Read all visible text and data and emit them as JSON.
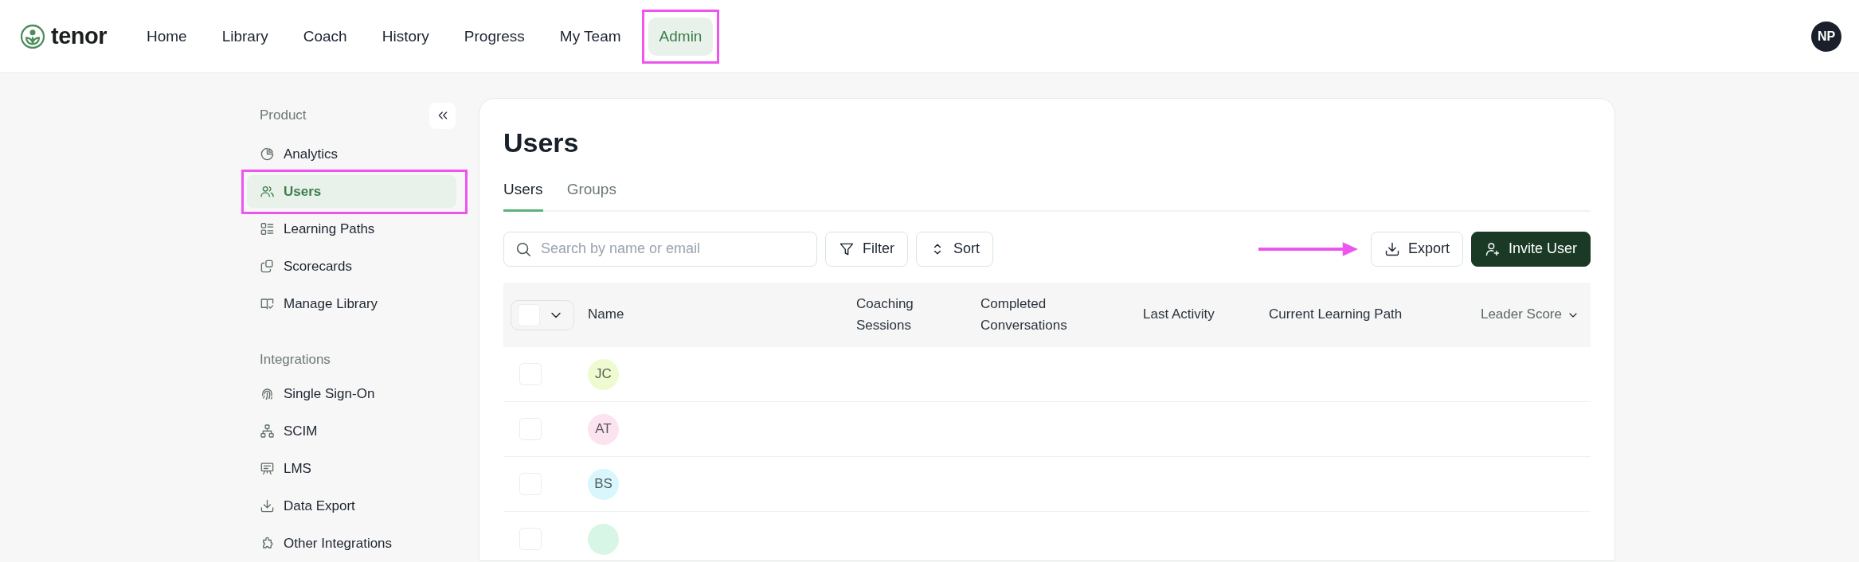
{
  "header": {
    "logo": "tenor",
    "nav": [
      {
        "label": "Home",
        "selected": false,
        "highlighted": false
      },
      {
        "label": "Library",
        "selected": false,
        "highlighted": false
      },
      {
        "label": "Coach",
        "selected": false,
        "highlighted": false
      },
      {
        "label": "History",
        "selected": false,
        "highlighted": false
      },
      {
        "label": "Progress",
        "selected": false,
        "highlighted": false
      },
      {
        "label": "My Team",
        "selected": false,
        "highlighted": false
      },
      {
        "label": "Admin",
        "selected": true,
        "highlighted": true
      }
    ],
    "avatar": "NP"
  },
  "sidebar": {
    "sections": [
      {
        "title": "Product",
        "items": [
          {
            "label": "Analytics",
            "selected": false,
            "highlighted": false
          },
          {
            "label": "Users",
            "selected": true,
            "highlighted": true
          },
          {
            "label": "Learning Paths",
            "selected": false,
            "highlighted": false
          },
          {
            "label": "Scorecards",
            "selected": false,
            "highlighted": false
          },
          {
            "label": "Manage Library",
            "selected": false,
            "highlighted": false
          }
        ]
      },
      {
        "title": "Integrations",
        "items": [
          {
            "label": "Single Sign-On",
            "selected": false,
            "highlighted": false
          },
          {
            "label": "SCIM",
            "selected": false,
            "highlighted": false
          },
          {
            "label": "LMS",
            "selected": false,
            "highlighted": false
          },
          {
            "label": "Data Export",
            "selected": false,
            "highlighted": false
          },
          {
            "label": "Other Integrations",
            "selected": false,
            "highlighted": false
          }
        ]
      }
    ]
  },
  "page": {
    "title": "Users",
    "tabs": [
      {
        "label": "Users",
        "selected": true
      },
      {
        "label": "Groups",
        "selected": false
      }
    ],
    "search": {
      "placeholder": "Search by name or email"
    },
    "filter_button": "Filter",
    "sort_button": "Sort",
    "export_button": {
      "label": "Export",
      "pointed_at": true
    },
    "invite_button": "Invite User",
    "table": {
      "select_all": {
        "checked": false
      },
      "columns": [
        {
          "label": "Name"
        },
        {
          "label": "Coaching Sessions"
        },
        {
          "label": "Completed Conversations"
        },
        {
          "label": "Last Activity"
        },
        {
          "label": "Current Learning Path"
        },
        {
          "label": "Leader Score",
          "sorted": true
        }
      ],
      "rows": [
        {
          "checked": false,
          "initials": "JC",
          "color": "#eefbd0"
        },
        {
          "checked": false,
          "initials": "AT",
          "color": "#fbe4ef"
        },
        {
          "checked": false,
          "initials": "BS",
          "color": "#d9f6fc"
        },
        {
          "checked": false,
          "color": "#d8f6e5"
        }
      ]
    }
  }
}
